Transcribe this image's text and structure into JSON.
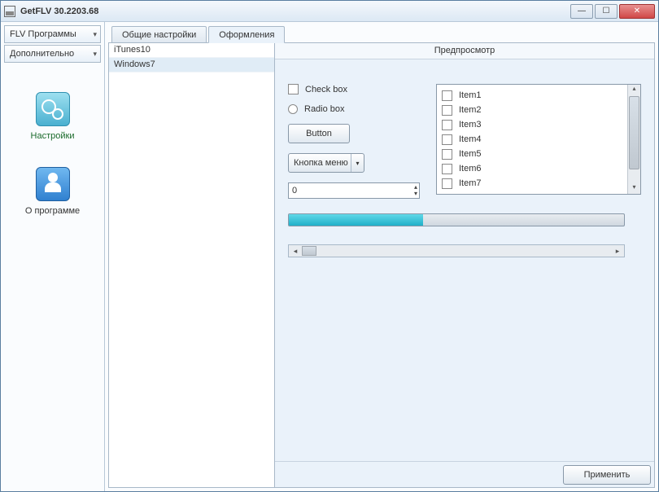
{
  "window": {
    "title": "GetFLV 30.2203.68"
  },
  "sidebar": {
    "dropdown1": "FLV Программы",
    "dropdown2": "Дополнительно",
    "items": [
      {
        "label": "Настройки"
      },
      {
        "label": "О программе"
      }
    ]
  },
  "tabs": [
    {
      "label": "Общие настройки",
      "active": false
    },
    {
      "label": "Оформления",
      "active": true
    }
  ],
  "themes": [
    {
      "name": "iTunes10",
      "selected": false
    },
    {
      "name": "Windows7",
      "selected": true
    }
  ],
  "preview": {
    "header": "Предпросмотр",
    "checkbox_label": "Check box",
    "radio_label": "Radio box",
    "button_label": "Button",
    "menu_button_label": "Кнопка меню",
    "spinner_value": "0",
    "list_items": [
      "Item1",
      "Item2",
      "Item3",
      "Item4",
      "Item5",
      "Item6",
      "Item7"
    ],
    "progress_percent": 40
  },
  "footer": {
    "apply_label": "Применить"
  }
}
